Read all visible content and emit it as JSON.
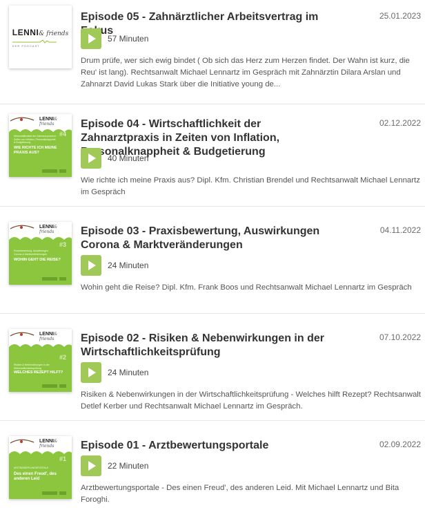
{
  "logo": {
    "name": "LENNI",
    "friends": "& friends",
    "sub": "DER PODCAST"
  },
  "episodes": [
    {
      "title": "Episode 05 - Zahnärztlicher Arbeitsvertrag im Fokus",
      "date": "25.01.2023",
      "duration": "57 Minuten",
      "description": "Drum prüfe, wer sich ewig bindet ( Ob sich das Herz zum Herzen findet. Der Wahn ist kurz, die Reu' ist lang). Rechtsanwalt Michael Lennartz im Gespräch mit Zahnärztin Dilara Arslan und Zahnarzt David Lukas Stark über die Initiative young de..."
    },
    {
      "title": "Episode 04 - Wirtschaftlichkeit der Zahnarztpraxis in Zeiten von Inflation, Personalknappheit & Budgetierung",
      "date": "02.12.2022",
      "duration": "40 Minuten",
      "description": "Wie richte ich meine Praxis aus? Dipl. Kfm. Christian Brendel und Rechtsanwalt Michael Lennartz im Gespräch",
      "thumb": {
        "num": "#4",
        "small": "Wirtschaftlichkeit der Zahnarzt-praxis in Zeiten von Inflation, Personalknappheit & Budgetierung",
        "big": "WIE RICHTE ICH MEINE PRAXIS AUS?"
      }
    },
    {
      "title": "Episode 03 - Praxisbewertung, Auswirkungen Corona & Marktveränderungen",
      "date": "04.11.2022",
      "duration": "24 Minuten",
      "description": "Wohin geht die Reise? Dipl. Kfm. Frank Boos und Rechtsanwalt Michael Lennartz im Gespräch",
      "thumb": {
        "num": "#3",
        "small": "Praxisbewertung, Auswirkungen Corona & Marktveränderungen",
        "big": "WOHIN GEHT DIE REISE?"
      }
    },
    {
      "title": "Episode 02 - Risiken & Nebenwirkungen in der Wirtschaftlichkeitsprüfung",
      "date": "07.10.2022",
      "duration": "24 Minuten",
      "description": "Risiken & Nebenwirkungen in der Wirtschaftlichkeitsprüfung - Welches hilft Rezept? Rechtsanwalt Detlef Kerber und Rechtsanwalt Michael Lennartz im Gespräch.",
      "thumb": {
        "num": "#2",
        "small": "Risiken & Nebenwirkungen in der Wirtschaftlichkeitsprüfung",
        "big": "WELCHES REZEPT HILFT?"
      }
    },
    {
      "title": "Episode 01 - Arztbewertungsportale",
      "date": "02.09.2022",
      "duration": "22 Minuten",
      "description": "Arztbewertungsportale - Des einen Freud', des anderen Leid. Mit Michael Lennartz und Bita Foroghi.",
      "thumb": {
        "num": "#1",
        "small": "ARZTBEWERTUNGSPORTALE",
        "big": "Des einen Freud', des anderen Leid"
      }
    }
  ]
}
